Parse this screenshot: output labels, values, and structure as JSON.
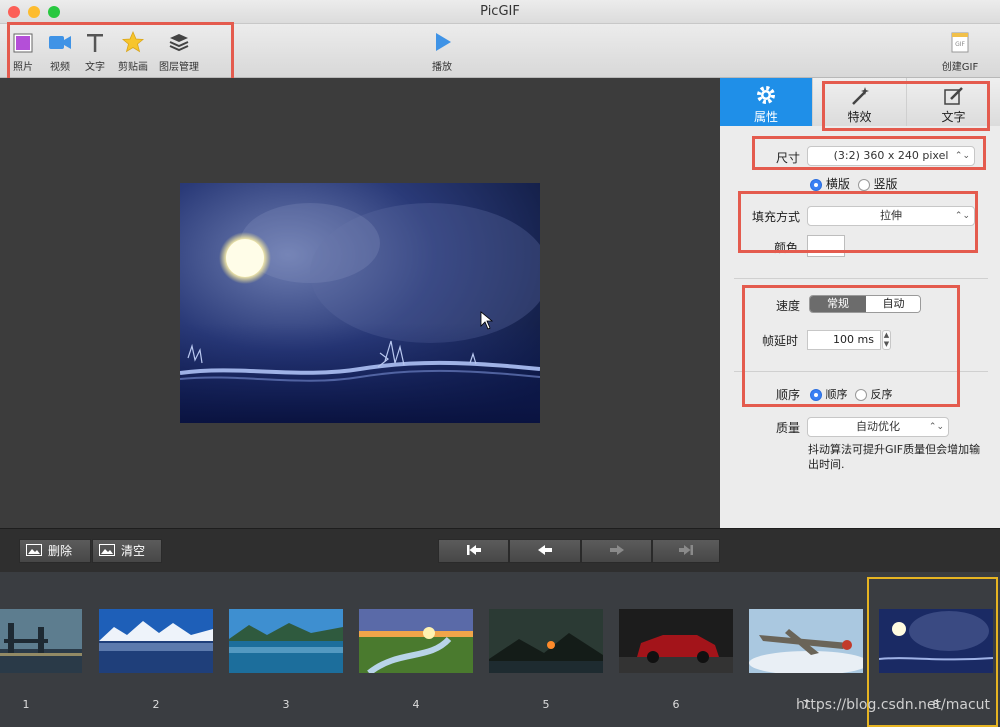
{
  "window": {
    "title": "PicGIF"
  },
  "toolbar": {
    "photo_label": "照片",
    "video_label": "视频",
    "text_label": "文字",
    "clipart_label": "剪贴画",
    "layers_label": "图层管理",
    "play_label": "播放",
    "create_label": "创建GIF",
    "create_icon_text": "GIF"
  },
  "panel": {
    "tabs": {
      "properties": "属性",
      "effects": "特效",
      "text": "文字"
    },
    "size_label": "尺寸",
    "size_value": "(3:2) 360 x 240 pixel",
    "orientation": {
      "landscape": "横版",
      "portrait": "竖版",
      "selected": "横版"
    },
    "fill_label": "填充方式",
    "fill_value": "拉伸",
    "color_label": "颜色",
    "speed_label": "速度",
    "speed_options": {
      "normal": "常规",
      "auto": "自动",
      "selected": "常规"
    },
    "delay_label": "帧延时",
    "delay_value": "100 ms",
    "order_label": "顺序",
    "order_options": {
      "forward": "顺序",
      "reverse": "反序",
      "selected": "顺序"
    },
    "quality_label": "质量",
    "quality_value": "自动优化",
    "quality_note": "抖动算法可提升GIF质量但会增加输出时间."
  },
  "bottom": {
    "delete_label": "删除",
    "clear_label": "清空"
  },
  "frames": [
    "1",
    "2",
    "3",
    "4",
    "5",
    "6",
    "7",
    "8"
  ],
  "selected_frame": "8",
  "watermark": "https://blog.csdn.net/macut",
  "colors": {
    "accent": "#2a8ee8",
    "highlight": "#e45b4e",
    "selection": "#e6b422"
  }
}
